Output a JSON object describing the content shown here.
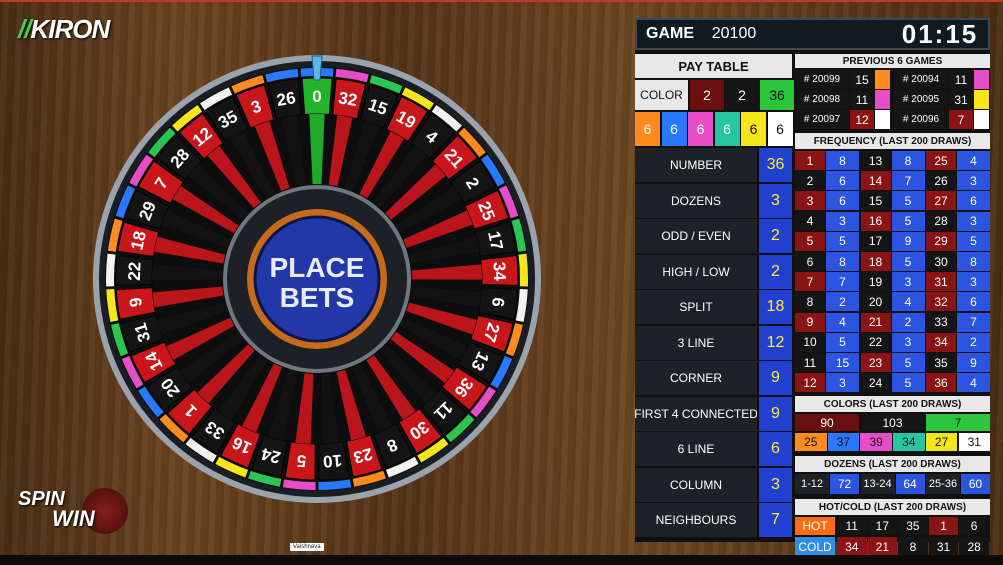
{
  "brand": {
    "logo_text": "KIRON",
    "game_logo_top": "SPIN",
    "game_logo_bottom": "WIN"
  },
  "header": {
    "game_label": "GAME",
    "game_number": "20100",
    "timer": "01:15"
  },
  "wheel": {
    "center_text_1": "PLACE",
    "center_text_2": "BETS",
    "sequence": [
      "0",
      "32",
      "15",
      "19",
      "4",
      "21",
      "2",
      "25",
      "17",
      "34",
      "6",
      "27",
      "13",
      "36",
      "11",
      "30",
      "8",
      "23",
      "10",
      "5",
      "24",
      "16",
      "33",
      "1",
      "20",
      "14",
      "31",
      "9",
      "22",
      "18",
      "29",
      "7",
      "28",
      "12",
      "35",
      "3",
      "26"
    ],
    "color_cycle": [
      "#2979ff",
      "#e64ec8",
      "#2ac64f",
      "#f5e61a",
      "#f2f2f2",
      "#ff8a1e"
    ],
    "colors": {
      "red": "#c9161b",
      "black": "#141414",
      "green": "#22b52a"
    }
  },
  "pay_table": {
    "title": "PAY TABLE",
    "color_label": "COLOR",
    "color_row1": [
      {
        "v": "2",
        "bg": "#6a0f0f",
        "fg": "#ffffff"
      },
      {
        "v": "2",
        "bg": "#151515",
        "fg": "#ffffff"
      },
      {
        "v": "36",
        "bg": "#2cc63b",
        "fg": "#111111"
      }
    ],
    "color_row2": [
      {
        "v": "6",
        "bg": "#ff8a1e",
        "fg": "#ffffff"
      },
      {
        "v": "6",
        "bg": "#2979ff",
        "fg": "#ffffff"
      },
      {
        "v": "6",
        "bg": "#e64ec8",
        "fg": "#ffffff"
      },
      {
        "v": "6",
        "bg": "#27c6a0",
        "fg": "#ffffff"
      },
      {
        "v": "6",
        "bg": "#f5e61a",
        "fg": "#111111"
      },
      {
        "v": "6",
        "bg": "#ffffff",
        "fg": "#111111"
      }
    ],
    "rows": [
      {
        "label": "NUMBER",
        "value": "36"
      },
      {
        "label": "DOZENS",
        "value": "3"
      },
      {
        "label": "ODD / EVEN",
        "value": "2"
      },
      {
        "label": "HIGH / LOW",
        "value": "2"
      },
      {
        "label": "SPLIT",
        "value": "18"
      },
      {
        "label": "3 LINE",
        "value": "12"
      },
      {
        "label": "CORNER",
        "value": "9"
      },
      {
        "label": "FIRST 4 CONNECTED",
        "value": "9"
      },
      {
        "label": "6 LINE",
        "value": "6"
      },
      {
        "label": "COLUMN",
        "value": "3"
      },
      {
        "label": "NEIGHBOURS",
        "value": "7"
      }
    ]
  },
  "previous_games": {
    "title": "PREVIOUS 6 GAMES",
    "items": [
      {
        "game": "# 20099",
        "num": "15",
        "nbg": "#151515",
        "color": "#ff8a1e"
      },
      {
        "game": "# 20094",
        "num": "11",
        "nbg": "#151515",
        "color": "#e64ec8"
      },
      {
        "game": "# 20098",
        "num": "11",
        "nbg": "#151515",
        "color": "#e64ec8"
      },
      {
        "game": "# 20095",
        "num": "31",
        "nbg": "#151515",
        "color": "#f5e61a"
      },
      {
        "game": "# 20097",
        "num": "12",
        "nbg": "#8a1414",
        "color": "#ffffff"
      },
      {
        "game": "# 20096",
        "num": "7",
        "nbg": "#8a1414",
        "color": "#ffffff"
      }
    ]
  },
  "frequency": {
    "title": "FREQUENCY (LAST 200 DRAWS)",
    "rows": [
      [
        "1",
        "8",
        "13",
        "8",
        "25",
        "4"
      ],
      [
        "2",
        "6",
        "14",
        "7",
        "26",
        "3"
      ],
      [
        "3",
        "6",
        "15",
        "5",
        "27",
        "6"
      ],
      [
        "4",
        "3",
        "16",
        "5",
        "28",
        "3"
      ],
      [
        "5",
        "5",
        "17",
        "9",
        "29",
        "5"
      ],
      [
        "6",
        "8",
        "18",
        "5",
        "30",
        "8"
      ],
      [
        "7",
        "7",
        "19",
        "3",
        "31",
        "3"
      ],
      [
        "8",
        "2",
        "20",
        "4",
        "32",
        "6"
      ],
      [
        "9",
        "4",
        "21",
        "2",
        "33",
        "7"
      ],
      [
        "10",
        "5",
        "22",
        "3",
        "34",
        "2"
      ],
      [
        "11",
        "15",
        "23",
        "5",
        "35",
        "9"
      ],
      [
        "12",
        "3",
        "24",
        "5",
        "36",
        "4"
      ]
    ],
    "num_bg": [
      [
        "#8a1414",
        "#151515",
        "#8a1414"
      ],
      [
        "#151515",
        "#8a1414",
        "#151515"
      ],
      [
        "#8a1414",
        "#151515",
        "#8a1414"
      ],
      [
        "#151515",
        "#8a1414",
        "#151515"
      ],
      [
        "#8a1414",
        "#151515",
        "#8a1414"
      ],
      [
        "#151515",
        "#8a1414",
        "#151515"
      ],
      [
        "#8a1414",
        "#151515",
        "#8a1414"
      ],
      [
        "#151515",
        "#151515",
        "#8a1414"
      ],
      [
        "#8a1414",
        "#8a1414",
        "#151515"
      ],
      [
        "#151515",
        "#151515",
        "#8a1414"
      ],
      [
        "#151515",
        "#8a1414",
        "#151515"
      ],
      [
        "#8a1414",
        "#151515",
        "#8a1414"
      ]
    ]
  },
  "colors_stats": {
    "title": "COLORS (LAST 200 DRAWS)",
    "row1": [
      {
        "v": "90",
        "bg": "#6a0f0f",
        "fg": "#ffffff"
      },
      {
        "v": "103",
        "bg": "#151515",
        "fg": "#ffffff"
      },
      {
        "v": "7",
        "bg": "#2cc63b",
        "fg": "#111111"
      }
    ],
    "row2": [
      {
        "v": "25",
        "bg": "#ff8a1e",
        "fg": "#111111"
      },
      {
        "v": "37",
        "bg": "#2979ff",
        "fg": "#111111"
      },
      {
        "v": "39",
        "bg": "#e64ec8",
        "fg": "#111111"
      },
      {
        "v": "34",
        "bg": "#27c6a0",
        "fg": "#111111"
      },
      {
        "v": "27",
        "bg": "#f5e61a",
        "fg": "#111111"
      },
      {
        "v": "31",
        "bg": "#ffffff",
        "fg": "#111111"
      }
    ]
  },
  "dozens_stats": {
    "title": "DOZENS (LAST 200 DRAWS)",
    "items": [
      {
        "label": "1-12",
        "value": "72"
      },
      {
        "label": "13-24",
        "value": "64"
      },
      {
        "label": "25-36",
        "value": "60"
      }
    ]
  },
  "hot_cold": {
    "title": "HOT/COLD (LAST 200 DRAWS)",
    "hot_label": "HOT",
    "cold_label": "COLD",
    "hot": [
      {
        "v": "11",
        "bg": "#151515"
      },
      {
        "v": "17",
        "bg": "#151515"
      },
      {
        "v": "35",
        "bg": "#151515"
      },
      {
        "v": "1",
        "bg": "#8a1414"
      },
      {
        "v": "6",
        "bg": "#151515"
      }
    ],
    "cold": [
      {
        "v": "34",
        "bg": "#8a1414"
      },
      {
        "v": "21",
        "bg": "#8a1414"
      },
      {
        "v": "8",
        "bg": "#151515"
      },
      {
        "v": "31",
        "bg": "#151515"
      },
      {
        "v": "28",
        "bg": "#151515"
      }
    ]
  },
  "overlay_tag": "Vaishnava"
}
